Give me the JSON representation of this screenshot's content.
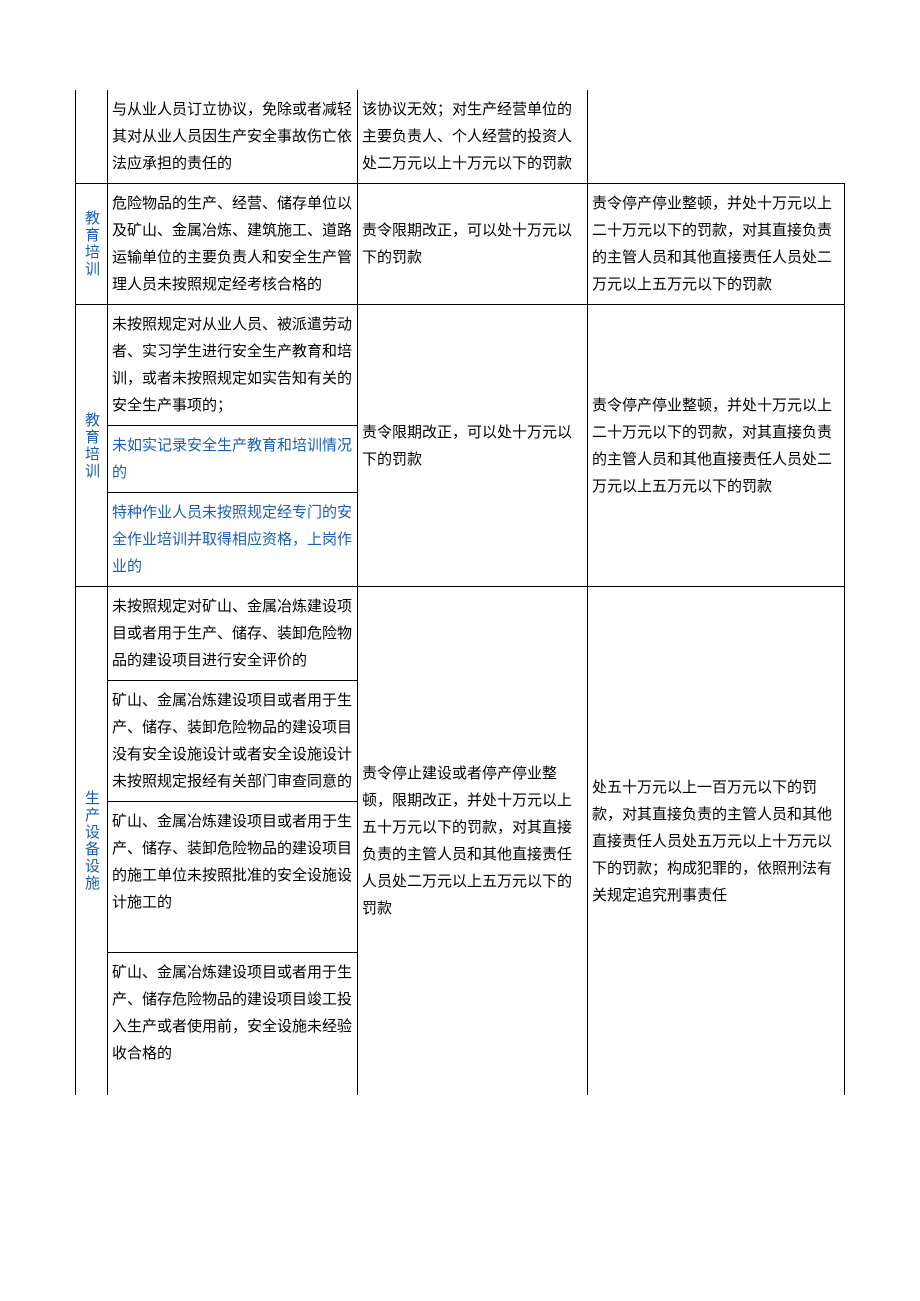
{
  "rows": [
    {
      "label": "",
      "desc": "与从业人员订立协议，免除或者减轻其对从业人员因生产安全事故伤亡依法应承担的责任的",
      "midRight": "该协议无效；对生产经营单位的主要负责人、个人经营的投资人处二万元以上十万元以下的罚款"
    },
    {
      "label": "教育培训",
      "desc": "危险物品的生产、经营、储存单位以及矿山、金属冶炼、建筑施工、道路运输单位的主要负责人和安全生产管理人员未按照规定经考核合格的",
      "mid": "责令限期改正，可以处十万元以下的罚款",
      "right": "责令停产停业整顿，并处十万元以上二十万元以下的罚款，对其直接负责的主管人员和其他直接责任人员处二万元以上五万元以下的罚款"
    },
    {
      "label": "教育培训",
      "descItems": [
        {
          "text": "未按照规定对从业人员、被派遣劳动者、实习学生进行安全生产教育和培训，或者未按照规定如实告知有关的安全生产事项的；",
          "blue": false
        },
        {
          "text": "未如实记录安全生产教育和培训情况的",
          "blue": true
        },
        {
          "text": "特种作业人员未按照规定经专门的安全作业培训并取得相应资格，上岗作业的",
          "blue": true
        }
      ],
      "mid": "责令限期改正，可以处十万元以下的罚款",
      "right": "责令停产停业整顿，并处十万元以上二十万元以下的罚款，对其直接负责的主管人员和其他直接责任人员处二万元以上五万元以下的罚款"
    },
    {
      "label": "生产设备设施",
      "descItems": [
        {
          "text": "未按照规定对矿山、金属冶炼建设项目或者用于生产、储存、装卸危险物品的建设项目进行安全评价的",
          "blue": false
        },
        {
          "text": "矿山、金属冶炼建设项目或者用于生产、储存、装卸危险物品的建设项目没有安全设施设计或者安全设施设计未按照规定报经有关部门审查同意的",
          "blue": false
        },
        {
          "text": "矿山、金属冶炼建设项目或者用于生产、储存、装卸危险物品的建设项目的施工单位未按照批准的安全设施设计施工的",
          "blue": false,
          "extraPad": true
        },
        {
          "text": "矿山、金属冶炼建设项目或者用于生产、储存危险物品的建设项目竣工投入生产或者使用前，安全设施未经验收合格的",
          "blue": false
        }
      ],
      "mid": "责令停止建设或者停产停业整顿，限期改正，并处十万元以上五十万元以下的罚款，对其直接负责的主管人员和其他直接责任人员处二万元以上五万元以下的罚款",
      "right": "处五十万元以上一百万元以下的罚款，对其直接负责的主管人员和其他直接责任人员处五万元以上十万元以下的罚款；构成犯罪的，依照刑法有关规定追究刑事责任"
    }
  ]
}
